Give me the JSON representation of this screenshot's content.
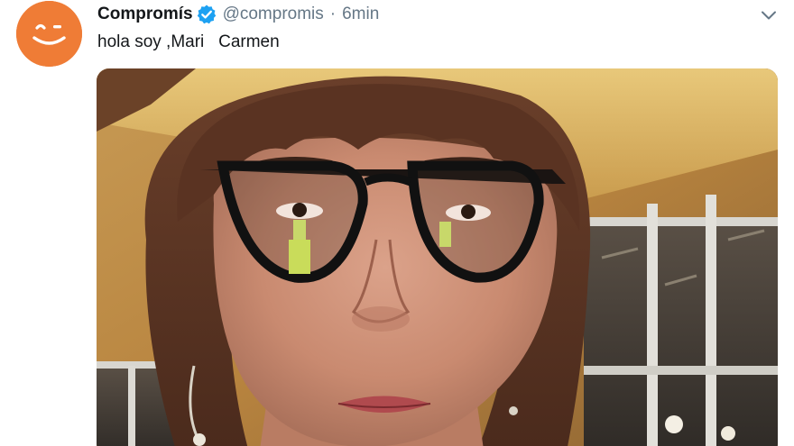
{
  "tweet": {
    "author": {
      "display_name": "Compromís",
      "handle": "@compromis",
      "verified": true,
      "avatar_icon": "smiley-logo-icon",
      "avatar_color": "#ef7c36"
    },
    "separator": "·",
    "timestamp": "6min",
    "text": "hola soy ,Mari   Carmen",
    "menu_icon": "chevron-down-icon",
    "media": {
      "type": "photo",
      "description_icon": "selfie-photo"
    }
  },
  "colors": {
    "name_text": "#14171a",
    "secondary_text": "#657786",
    "verified_blue": "#1da1f2",
    "brand_orange": "#ef7c36"
  }
}
